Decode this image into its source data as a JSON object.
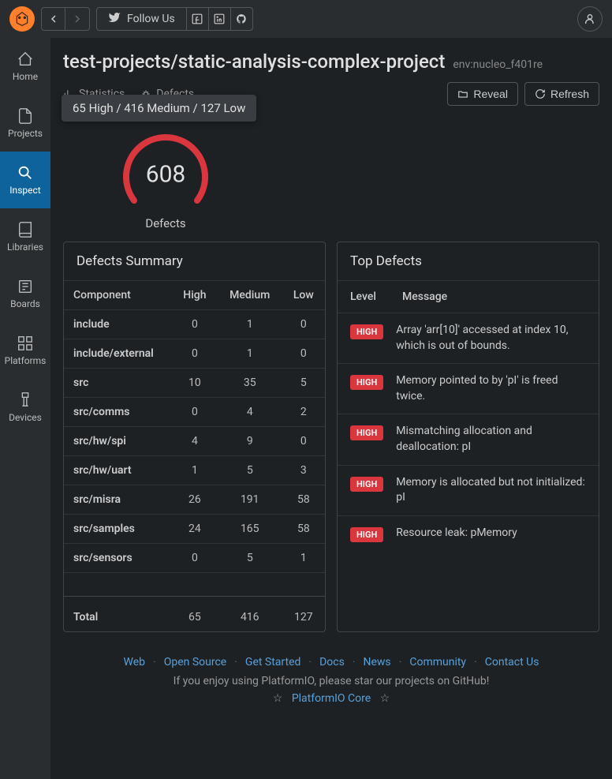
{
  "topbar": {
    "follow_label": "Follow Us"
  },
  "sidebar": {
    "items": [
      {
        "label": "Home",
        "icon": "home"
      },
      {
        "label": "Projects",
        "icon": "file"
      },
      {
        "label": "Inspect",
        "icon": "search",
        "active": true
      },
      {
        "label": "Libraries",
        "icon": "book"
      },
      {
        "label": "Boards",
        "icon": "board"
      },
      {
        "label": "Platforms",
        "icon": "grid"
      },
      {
        "label": "Devices",
        "icon": "usb"
      }
    ]
  },
  "page": {
    "title": "test-projects/static-analysis-complex-project",
    "env": "env:nucleo_f401re",
    "tabs": {
      "stats": "Statistics",
      "defects": "Defects"
    },
    "buttons": {
      "reveal": "Reveal",
      "refresh": "Refresh"
    },
    "tooltip": "65 High / 416 Medium / 127 Low",
    "gauge": {
      "value": "608",
      "label": "Defects"
    }
  },
  "chart_data": {
    "type": "bar",
    "title": "Defects",
    "value": 608,
    "breakdown": {
      "High": 65,
      "Medium": 416,
      "Low": 127
    }
  },
  "summary": {
    "title": "Defects Summary",
    "columns": [
      "Component",
      "High",
      "Medium",
      "Low"
    ],
    "rows": [
      {
        "component": "include",
        "high": 0,
        "medium": 1,
        "low": 0
      },
      {
        "component": "include/external",
        "high": 0,
        "medium": 1,
        "low": 0
      },
      {
        "component": "src",
        "high": 10,
        "medium": 35,
        "low": 5
      },
      {
        "component": "src/comms",
        "high": 0,
        "medium": 4,
        "low": 2
      },
      {
        "component": "src/hw/spi",
        "high": 4,
        "medium": 9,
        "low": 0
      },
      {
        "component": "src/hw/uart",
        "high": 1,
        "medium": 5,
        "low": 3
      },
      {
        "component": "src/misra",
        "high": 26,
        "medium": 191,
        "low": 58
      },
      {
        "component": "src/samples",
        "high": 24,
        "medium": 165,
        "low": 58
      },
      {
        "component": "src/sensors",
        "high": 0,
        "medium": 5,
        "low": 1
      }
    ],
    "total": {
      "label": "Total",
      "high": 65,
      "medium": 416,
      "low": 127
    }
  },
  "top_defects": {
    "title": "Top Defects",
    "columns": {
      "level": "Level",
      "message": "Message"
    },
    "rows": [
      {
        "level": "HIGH",
        "message": "Array 'arr[10]' accessed at index 10, which is out of bounds."
      },
      {
        "level": "HIGH",
        "message": "Memory pointed to by 'pI' is freed twice."
      },
      {
        "level": "HIGH",
        "message": "Mismatching allocation and deallocation: pI"
      },
      {
        "level": "HIGH",
        "message": "Memory is allocated but not initialized: pI"
      },
      {
        "level": "HIGH",
        "message": "Resource leak: pMemory"
      }
    ]
  },
  "footer": {
    "links": [
      "Web",
      "Open Source",
      "Get Started",
      "Docs",
      "News",
      "Community",
      "Contact Us"
    ],
    "line2": "If you enjoy using PlatformIO, please star our projects on GitHub!",
    "core": "PlatformIO Core"
  }
}
